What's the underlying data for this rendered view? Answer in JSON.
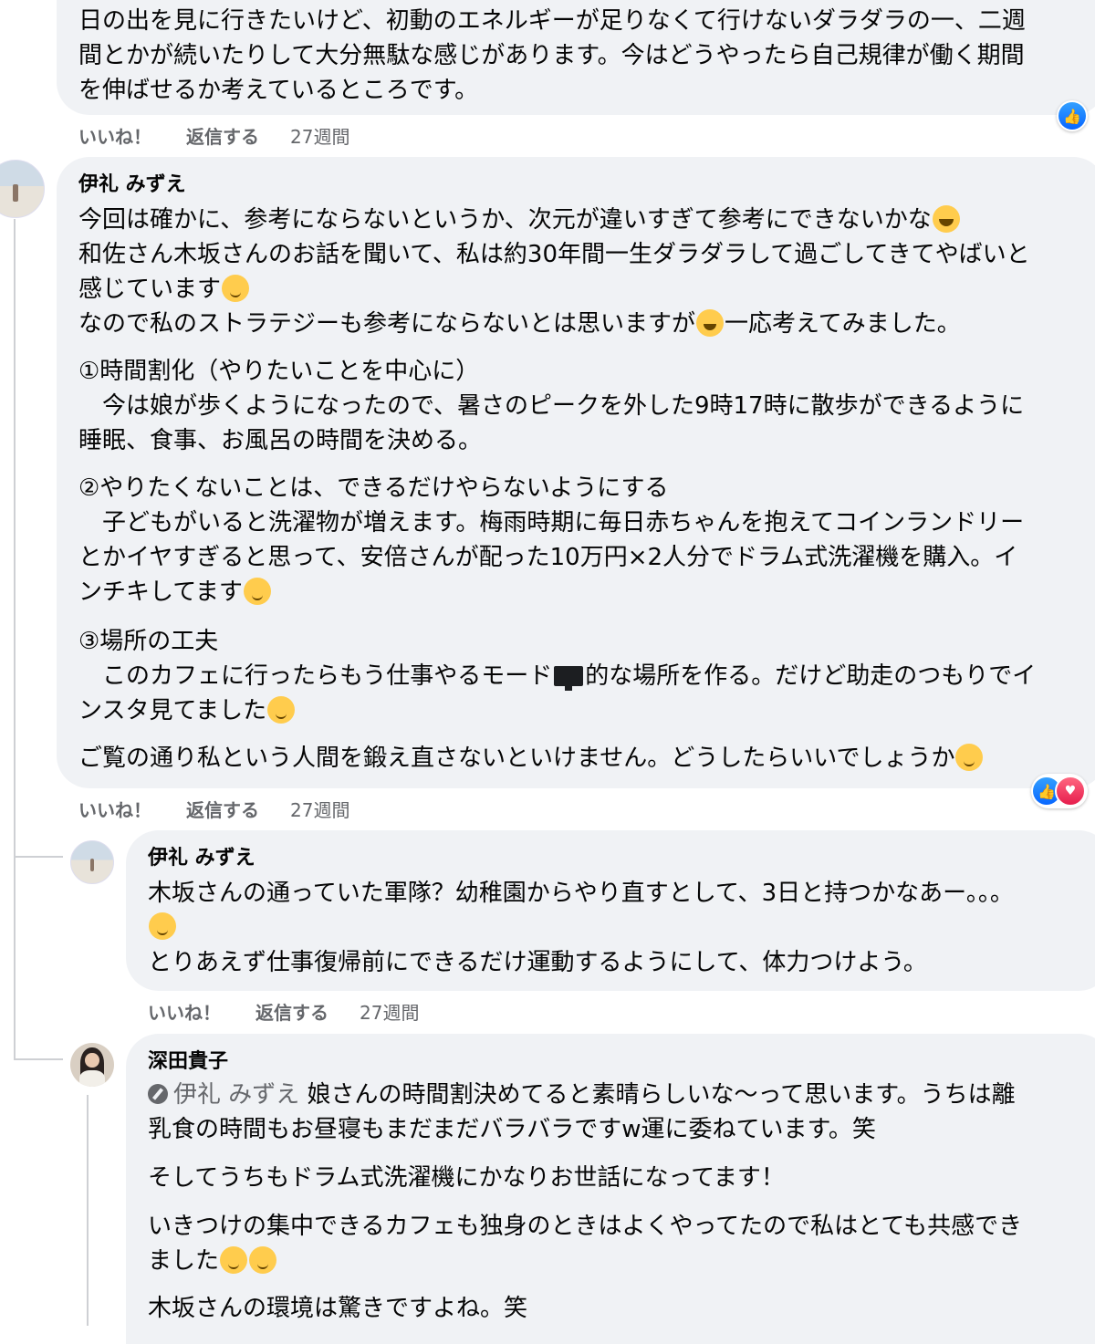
{
  "comment0": {
    "lines": [
      "日の出を見に行きたいけど、初動のエネルギーが足りなくて行けないダラダラの一、二週",
      "間とかが続いたりして大分無駄な感じがあります。今はどうやったら自己規律が働く期間",
      "を伸ばせるか考えているところです。"
    ],
    "like": "いいね！",
    "reply": "返信する",
    "time": "27週間",
    "reaction_icons": [
      "like-icon"
    ]
  },
  "comment1": {
    "author": "伊礼 みずえ",
    "l1": "今回は確かに、参考にならないというか、次元が違いすぎて参考にできないかな",
    "l2": "和佐さん木坂さんのお話を聞いて、私は約30年間一生ダラダラして過ごしてきてやばいと",
    "l3": "感じています",
    "l4a": "なので私のストラテジーも参考にならないとは思いますが",
    "l4b": "一応考えてみました。",
    "p1_title": "①時間割化（やりたいことを中心に）",
    "p1_a": "　今は娘が歩くようになったので、暑さのピークを外した9時17時に散歩ができるように",
    "p1_b": "睡眠、食事、お風呂の時間を決める。",
    "p2_title": "②やりたくないことは、できるだけやらないようにする",
    "p2_a": "　子どもがいると洗濯物が増えます。梅雨時期に毎日赤ちゃんを抱えてコインランドリー",
    "p2_b": "とかイヤすぎると思って、安倍さんが配った10万円×2人分でドラム式洗濯機を購入。イ",
    "p2_c": "ンチキしてます",
    "p3_title": "③場所の工夫",
    "p3_a1": "　このカフェに行ったらもう仕事やるモード",
    "p3_a2": "的な場所を作る。だけど助走のつもりでイ",
    "p3_b": "ンスタ見てました",
    "closing": "ご覧の通り私という人間を鍛え直さないといけません。どうしたらいいでしょうか",
    "like": "いいね！",
    "reply": "返信する",
    "time": "27週間",
    "reaction_icons": [
      "like-icon",
      "love-icon"
    ]
  },
  "reply1": {
    "author": "伊礼 みずえ",
    "l1": "木坂さんの通っていた軍隊？幼稚園からやり直すとして、3日と持つかなあー。。。",
    "l2": "とりあえず仕事復帰前にできるだけ運動するようにして、体力つけよう。",
    "like": "いいね！",
    "reply": "返信する",
    "time": "27週間"
  },
  "reply2": {
    "author": "深田貴子",
    "mention": "伊礼 みずえ",
    "l1": " 娘さんの時間割決めてると素晴らしいな〜って思います。うちは離",
    "l2": "乳食の時間もお昼寝もまだまだバラバラですw運に委ねています。笑",
    "l3": "そしてうちもドラム式洗濯機にかなりお世話になってます！",
    "l4": "いきつけの集中できるカフェも独身のときはよくやってたので私はとても共感でき",
    "l5": "ました",
    "l6": "木坂さんの環境は驚きですよね。笑"
  }
}
